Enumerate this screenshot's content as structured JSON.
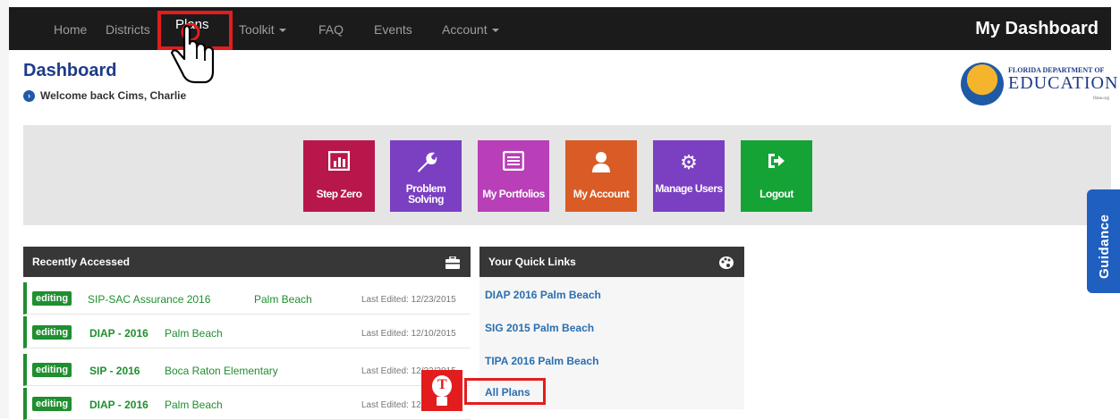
{
  "nav": {
    "items": [
      "Home",
      "Districts",
      "Plans",
      "Toolkit",
      "FAQ",
      "Events",
      "Account"
    ],
    "active": "Plans",
    "brand": "My Dashboard"
  },
  "header": {
    "title": "Dashboard",
    "welcome": "Welcome back Cims, Charlie"
  },
  "logo": {
    "line1": "FLORIDA DEPARTMENT OF",
    "line2": "EDUCATION",
    "url": "fldoe.org"
  },
  "tiles": [
    {
      "label": "Step Zero",
      "icon": "bar-chart-icon",
      "color": "#b8174b"
    },
    {
      "label": "Problem Solving",
      "icon": "wrench-icon",
      "color": "#7b3fc2"
    },
    {
      "label": "My Portfolios",
      "icon": "list-icon",
      "color": "#b83fb8"
    },
    {
      "label": "My Account",
      "icon": "user-icon",
      "color": "#d95b25"
    },
    {
      "label": "Manage Users",
      "icon": "gear-icon",
      "color": "#7b3fc2"
    },
    {
      "label": "Logout",
      "icon": "sign-out-icon",
      "color": "#16a336"
    }
  ],
  "guidance": "Guidance",
  "recent": {
    "title": "Recently Accessed",
    "rows": [
      {
        "status": "editing",
        "plan": "SIP-SAC Assurance 2016",
        "school": "Palm Beach",
        "edited": "Last Edited: 12/23/2015"
      },
      {
        "status": "editing",
        "plan": "DIAP - 2016",
        "school": "Palm Beach",
        "edited": "Last Edited: 12/10/2015"
      },
      {
        "status": "editing",
        "plan": "SIP - 2016",
        "school": "Boca Raton Elementary",
        "edited": "Last Edited: 12/23/2015"
      },
      {
        "status": "editing",
        "plan": "DIAP - 2016",
        "school": "Palm Beach",
        "edited": "Last Edited: 12/10/2015"
      }
    ]
  },
  "quick": {
    "title": "Your Quick Links",
    "links": [
      "DIAP 2016 Palm Beach",
      "SIG 2015 Palm Beach",
      "TIPA 2016 Palm Beach",
      "All Plans"
    ]
  },
  "colors": {
    "highlight": "#e31d1d",
    "navbar": "#1b1b1b",
    "link": "#2a6fb0",
    "editing": "#1f8f2f"
  }
}
